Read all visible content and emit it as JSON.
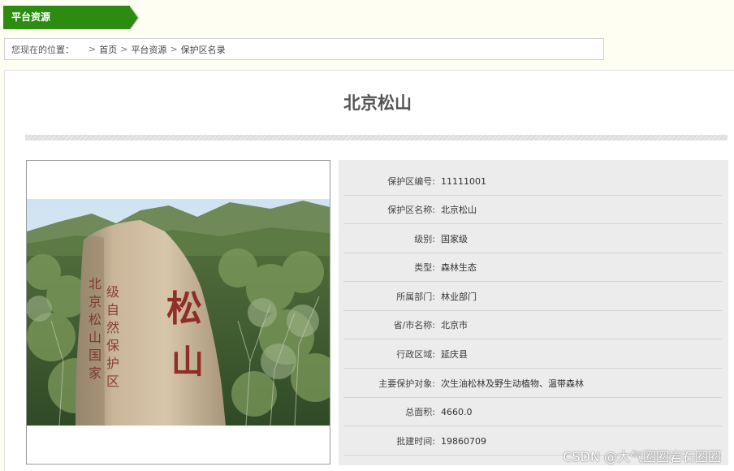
{
  "section_tab": {
    "label": "平台资源"
  },
  "breadcrumb": {
    "prefix": "您现在的位置：",
    "items": [
      "首页",
      "平台资源",
      "保护区名录"
    ],
    "separator": ">"
  },
  "page_title": "北京松山",
  "details": [
    {
      "label": "保护区编号:",
      "value": "11111001"
    },
    {
      "label": "保护区名称:",
      "value": "北京松山"
    },
    {
      "label": "级别:",
      "value": "国家级"
    },
    {
      "label": "类型:",
      "value": "森林生态"
    },
    {
      "label": "所属部门:",
      "value": "林业部门"
    },
    {
      "label": "省/市名称:",
      "value": "北京市"
    },
    {
      "label": "行政区域:",
      "value": "延庆县"
    },
    {
      "label": "主要保护对象:",
      "value": "次生油松林及野生动植物、温带森林"
    },
    {
      "label": "总面积:",
      "value": "4660.0"
    },
    {
      "label": "批建时间:",
      "value": "19860709"
    }
  ],
  "photo": {
    "carved_text": "松山",
    "side_text": "北京松山国家级自然保护区"
  },
  "watermark": "CSDN @大气圈圈岩石圈圈",
  "colors": {
    "accent": "#2e8b12",
    "page_bg": "#fefef2",
    "panel_bg": "#ececec",
    "title": "#555555"
  }
}
